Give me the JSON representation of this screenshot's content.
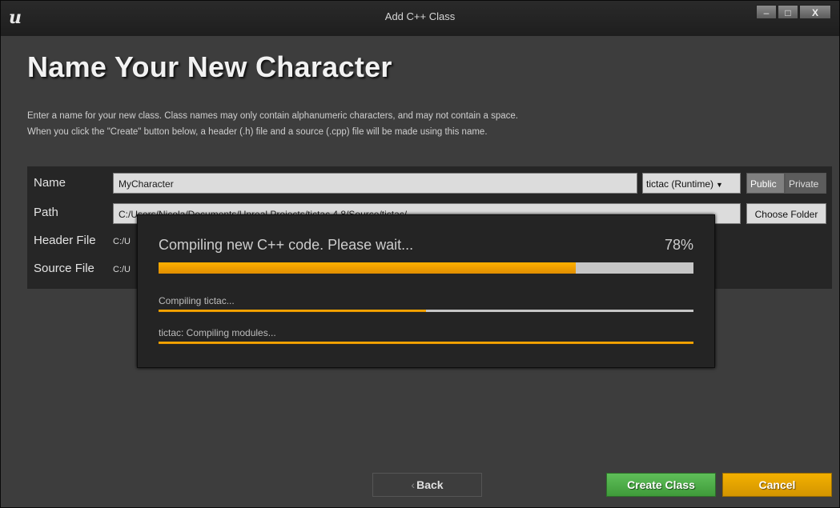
{
  "window": {
    "logo": "u",
    "title": "Add C++ Class",
    "controls": {
      "minimize": "–",
      "maximize": "□",
      "close": "X"
    }
  },
  "page": {
    "title": "Name Your New Character",
    "description_line1": "Enter a name for your new class. Class names may only contain alphanumeric characters, and may not contain a space.",
    "description_line2": "When you click the \"Create\" button below, a header (.h) file and a source (.cpp) file will be made using this name."
  },
  "form": {
    "name_label": "Name",
    "name_value": "MyCharacter",
    "module_value": "tictac (Runtime)",
    "public_label": "Public",
    "private_label": "Private",
    "path_label": "Path",
    "path_value": "C:/Users/Nicola/Documents/Unreal Projects/tictac 4.8/Source/tictac/",
    "choose_folder_label": "Choose Folder",
    "header_label": "Header File",
    "header_value": "C:/U",
    "source_label": "Source File",
    "source_value": "C:/U"
  },
  "progress": {
    "title": "Compiling new C++ code.  Please wait...",
    "percent_text": "78%",
    "percent": 0.78,
    "sub1_label": "Compiling tictac...",
    "sub1_fraction": 0.5,
    "sub2_label": "tictac: Compiling modules...",
    "sub2_fraction": 1.0
  },
  "buttons": {
    "back_chevron": "‹",
    "back_label": "Back",
    "create_label": "Create Class",
    "cancel_label": "Cancel"
  },
  "colors": {
    "progress_fill": "#f0a000",
    "create_green": "#4fae49",
    "cancel_orange": "#e6a300"
  }
}
